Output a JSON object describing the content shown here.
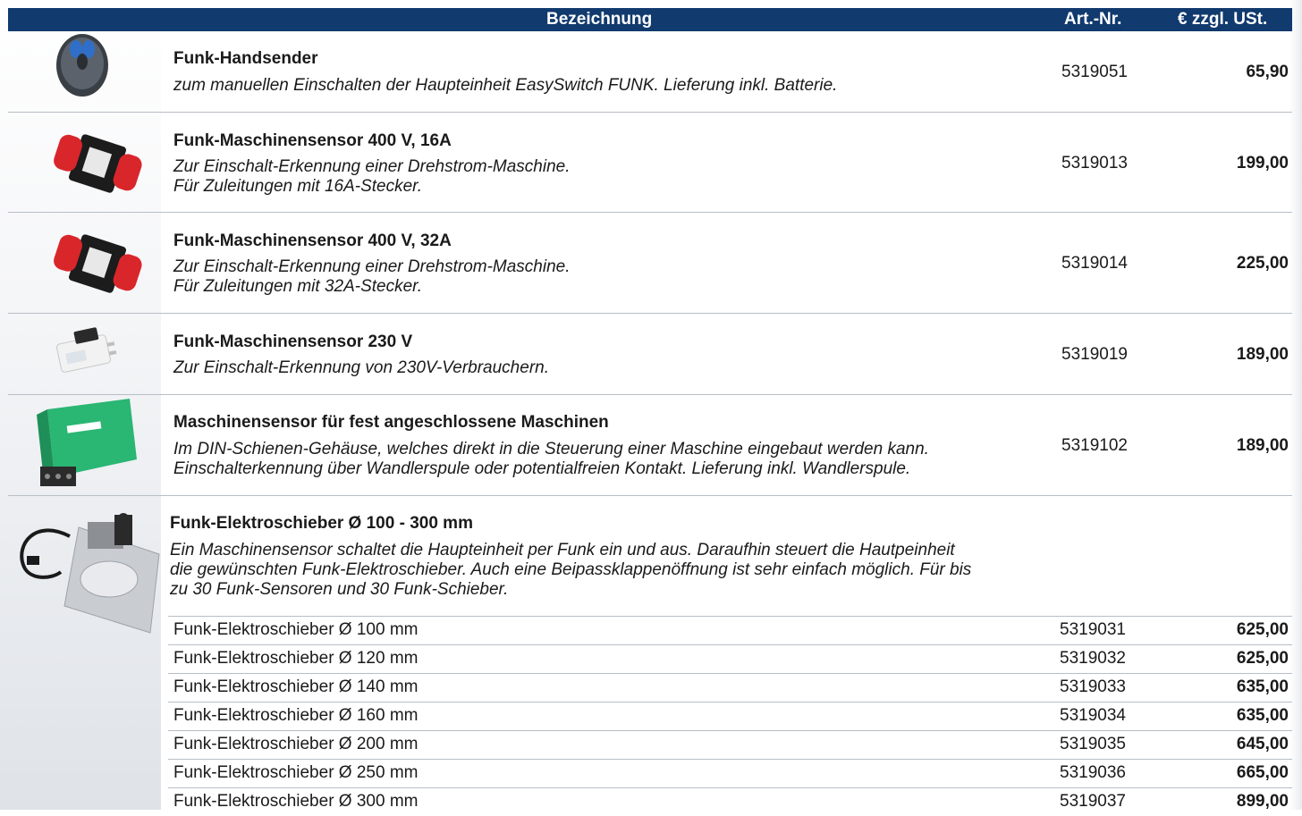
{
  "header": {
    "description": "Bezeichnung",
    "article_number": "Art.-Nr.",
    "price": "€ zzgl. USt."
  },
  "products": [
    {
      "title": "Funk-Handsender",
      "description": "zum manuellen Einschalten der Haupteinheit EasySwitch FUNK. Lieferung inkl. Batterie.",
      "article_number": "5319051",
      "price": "65,90"
    },
    {
      "title": "Funk-Maschinensensor 400 V, 16A",
      "description": "Zur Einschalt-Erkennung einer Drehstrom-Maschine.\nFür Zuleitungen mit 16A-Stecker.",
      "article_number": "5319013",
      "price": "199,00"
    },
    {
      "title": "Funk-Maschinensensor 400 V, 32A",
      "description": "Zur Einschalt-Erkennung einer Drehstrom-Maschine.\nFür Zuleitungen mit 32A-Stecker.",
      "article_number": "5319014",
      "price": "225,00"
    },
    {
      "title": "Funk-Maschinensensor 230 V",
      "description": "Zur Einschalt-Erkennung von 230V-Verbrauchern.",
      "article_number": "5319019",
      "price": "189,00"
    },
    {
      "title": "Maschinensensor für fest angeschlossene Maschinen",
      "description": "Im DIN-Schienen-Gehäuse, welches direkt in die Steuerung einer Maschine eingebaut werden kann.\nEinschalterkennung über Wandlerspule oder potentialfreien Kontakt. Lieferung inkl. Wandlerspule.",
      "article_number": "5319102",
      "price": "189,00"
    }
  ],
  "group": {
    "title": "Funk-Elektroschieber Ø 100 - 300 mm",
    "description": "Ein Maschinensensor schaltet die Haupteinheit per Funk ein und aus. Daraufhin steuert die Hautpeinheit\ndie gewünschten Funk-Elektroschieber. Auch eine Beipassklappenöffnung ist sehr einfach möglich. Für bis\nzu 30 Funk-Sensoren und 30 Funk-Schieber.",
    "variants": [
      {
        "name": "Funk-Elektroschieber Ø 100 mm",
        "article_number": "5319031",
        "price": "625,00"
      },
      {
        "name": "Funk-Elektroschieber Ø 120 mm",
        "article_number": "5319032",
        "price": "625,00"
      },
      {
        "name": "Funk-Elektroschieber Ø 140 mm",
        "article_number": "5319033",
        "price": "635,00"
      },
      {
        "name": "Funk-Elektroschieber Ø 160 mm",
        "article_number": "5319034",
        "price": "635,00"
      },
      {
        "name": "Funk-Elektroschieber Ø 200 mm",
        "article_number": "5319035",
        "price": "645,00"
      },
      {
        "name": "Funk-Elektroschieber Ø 250 mm",
        "article_number": "5319036",
        "price": "665,00"
      },
      {
        "name": "Funk-Elektroschieber Ø 300 mm",
        "article_number": "5319037",
        "price": "899,00"
      }
    ]
  },
  "colors": {
    "header_bg": "#113a6e",
    "sensor_red": "#d9262b",
    "sensor_green": "#2ab673"
  },
  "icons": [
    "remote-control-icon",
    "cee-sensor-16a-icon",
    "cee-sensor-32a-icon",
    "plug-sensor-230v-icon",
    "din-rail-sensor-icon",
    "electric-damper-icon"
  ]
}
